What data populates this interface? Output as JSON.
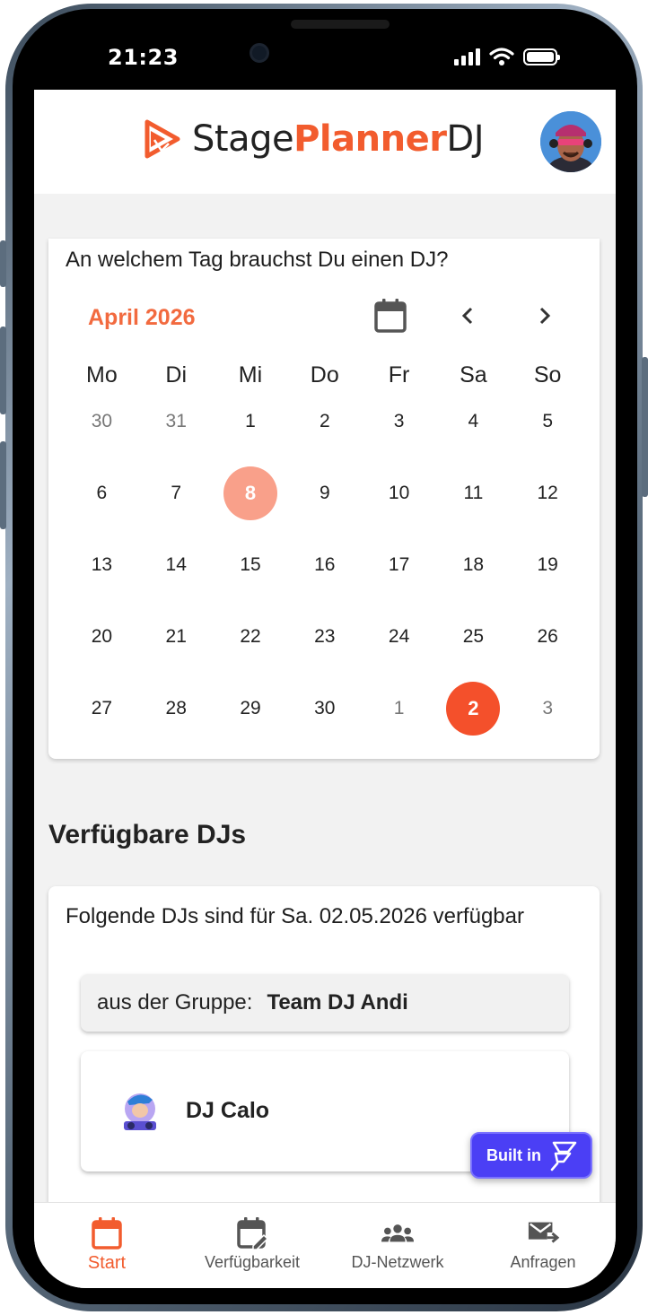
{
  "status_bar": {
    "time": "21:23"
  },
  "header": {
    "logo_part1": "Stage",
    "logo_part2": "Planner",
    "logo_part3": "DJ"
  },
  "calendar": {
    "question": "An welchem Tag brauchst Du einen DJ?",
    "month_label": "April 2026",
    "weekdays": [
      "Mo",
      "Di",
      "Mi",
      "Do",
      "Fr",
      "Sa",
      "So"
    ],
    "weeks": [
      [
        "30",
        "31",
        "1",
        "2",
        "3",
        "4",
        "5"
      ],
      [
        "6",
        "7",
        "8",
        "9",
        "10",
        "11",
        "12"
      ],
      [
        "13",
        "14",
        "15",
        "16",
        "17",
        "18",
        "19"
      ],
      [
        "20",
        "21",
        "22",
        "23",
        "24",
        "25",
        "26"
      ],
      [
        "27",
        "28",
        "29",
        "30",
        "1",
        "2",
        "3"
      ]
    ],
    "today": "8",
    "selected": "2"
  },
  "available": {
    "section_title": "Verfügbare DJs",
    "description": "Folgende DJs sind für Sa. 02.05.2026 verfügbar",
    "group_prefix": "aus der Gruppe:",
    "group_name": "Team DJ Andi",
    "dj_name": "DJ Calo"
  },
  "badge": {
    "label": "Built in"
  },
  "bottom_nav": {
    "items": [
      {
        "label": "Start",
        "icon": "calendar-icon"
      },
      {
        "label": "Verfügbarkeit",
        "icon": "calendar-edit-icon"
      },
      {
        "label": "DJ-Netzwerk",
        "icon": "group-icon"
      },
      {
        "label": "Anfragen",
        "icon": "mail-forward-icon"
      }
    ]
  },
  "colors": {
    "accent": "#f25c2e",
    "today_circle": "#f9a08a",
    "selected_circle": "#f4502b",
    "badge": "#4b3ff5"
  }
}
